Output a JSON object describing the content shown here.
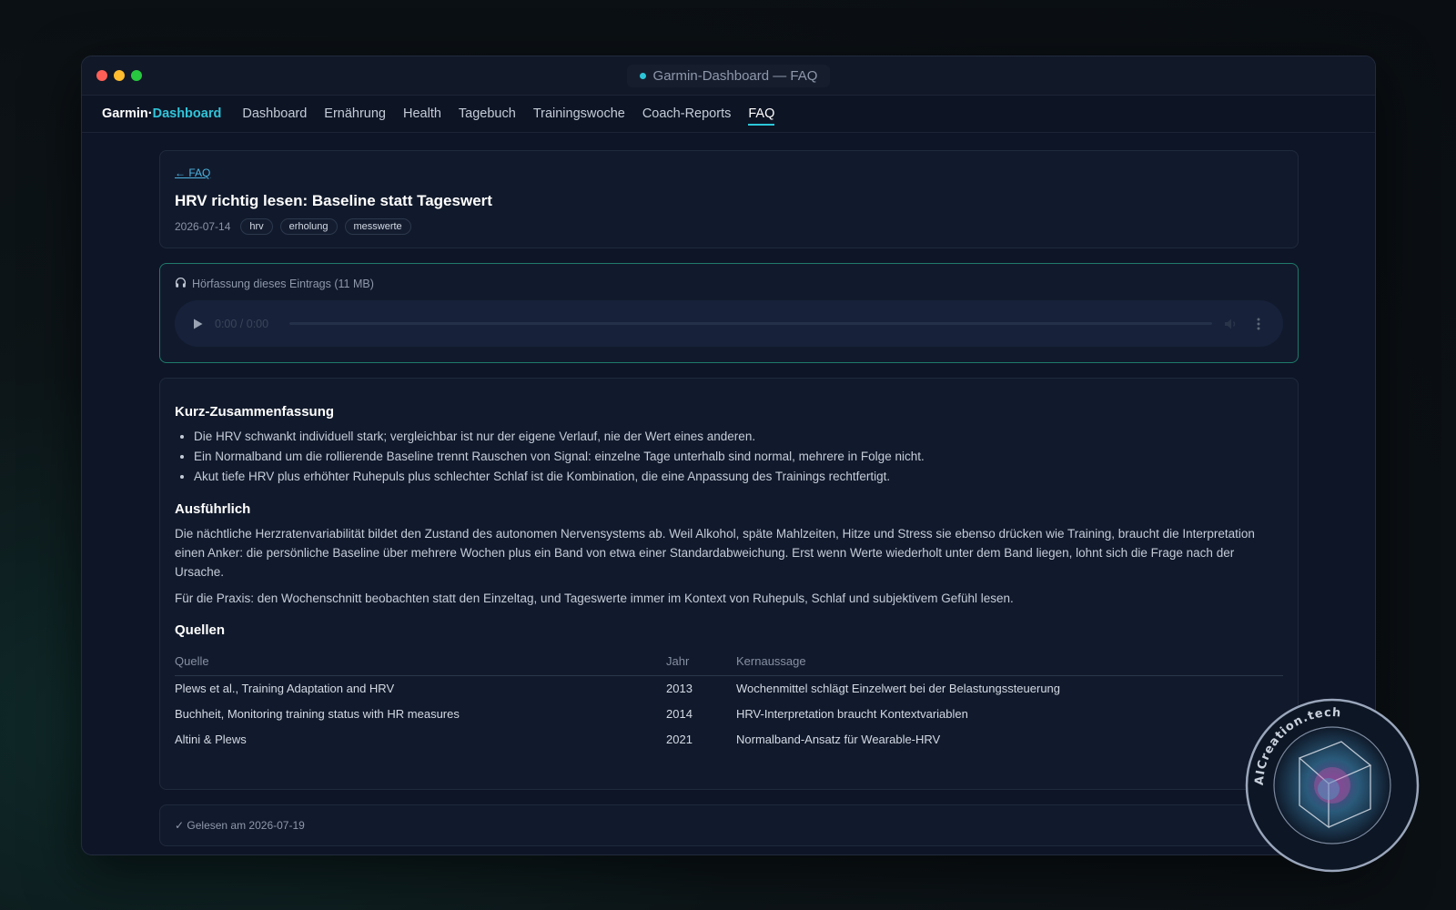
{
  "window": {
    "title": "Garmin-Dashboard — FAQ"
  },
  "nav": {
    "brand_part1": "Garmin·",
    "brand_part2": "Dashboard",
    "items": [
      "Dashboard",
      "Ernährung",
      "Health",
      "Tagebuch",
      "Trainingswoche",
      "Coach-Reports",
      "FAQ"
    ],
    "active": "FAQ"
  },
  "header": {
    "back_link": "← FAQ",
    "title": "HRV richtig lesen: Baseline statt Tageswert",
    "date": "2026-07-14",
    "tags": [
      "hrv",
      "erholung",
      "messwerte"
    ]
  },
  "audio": {
    "label": "Hörfassung dieses Eintrags (11 MB)",
    "time": "0:00 / 0:00",
    "icon": "headphones-icon"
  },
  "body": {
    "summary_heading": "Kurz-Zusammenfassung",
    "summary_items": [
      "Die HRV schwankt individuell stark; vergleichbar ist nur der eigene Verlauf, nie der Wert eines anderen.",
      "Ein Normalband um die rollierende Baseline trennt Rauschen von Signal: einzelne Tage unterhalb sind normal, mehrere in Folge nicht.",
      "Akut tiefe HRV plus erhöhter Ruhepuls plus schlechter Schlaf ist die Kombination, die eine Anpassung des Trainings rechtfertigt."
    ],
    "detail_heading": "Ausführlich",
    "detail_paragraphs": [
      "Die nächtliche Herzratenvariabilität bildet den Zustand des autonomen Nervensystems ab. Weil Alkohol, späte Mahlzeiten, Hitze und Stress sie ebenso drücken wie Training, braucht die Interpretation einen Anker: die persönliche Baseline über mehrere Wochen plus ein Band von etwa einer Standardabweichung. Erst wenn Werte wiederholt unter dem Band liegen, lohnt sich die Frage nach der Ursache.",
      "Für die Praxis: den Wochenschnitt beobachten statt den Einzeltag, und Tageswerte immer im Kontext von Ruhepuls, Schlaf und subjektivem Gefühl lesen."
    ],
    "sources_heading": "Quellen",
    "sources_columns": [
      "Quelle",
      "Jahr",
      "Kernaussage"
    ],
    "sources_rows": [
      [
        "Plews et al., Training Adaptation and HRV",
        "2013",
        "Wochenmittel schlägt Einzelwert bei der Belastungssteuerung"
      ],
      [
        "Buchheit, Monitoring training status with HR measures",
        "2014",
        "HRV-Interpretation braucht Kontextvariablen"
      ],
      [
        "Altini & Plews",
        "2021",
        "Normalband-Ansatz für Wearable-HRV"
      ]
    ]
  },
  "footer": {
    "read_status": "✓ Gelesen am 2026-07-19"
  },
  "watermark": {
    "text": "AICreation.tech"
  },
  "colors": {
    "accent": "#2cc6d8",
    "audio_border": "#1f7a6a",
    "background": "#0e1527"
  }
}
